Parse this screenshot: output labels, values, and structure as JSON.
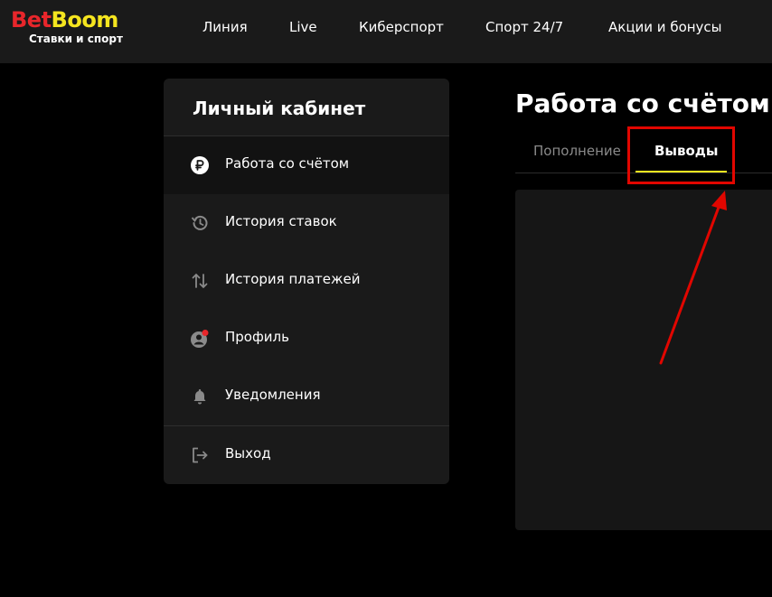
{
  "header": {
    "logo": {
      "bet": "Bet",
      "boom": "Boom",
      "tagline": "Ставки и спорт"
    },
    "nav": [
      "Линия",
      "Live",
      "Киберспорт",
      "Спорт 24/7",
      "Акции и бонусы"
    ]
  },
  "sidebar": {
    "title": "Личный кабинет",
    "items": [
      {
        "label": "Работа со счётом",
        "icon": "ruble-icon",
        "active": true
      },
      {
        "label": "История ставок",
        "icon": "history-icon"
      },
      {
        "label": "История платежей",
        "icon": "transfer-arrows-icon"
      },
      {
        "label": "Профиль",
        "icon": "profile-icon",
        "badge": true
      },
      {
        "label": "Уведомления",
        "icon": "bell-icon"
      },
      {
        "label": "Выход",
        "icon": "logout-icon"
      }
    ]
  },
  "main": {
    "title": "Работа со счётом",
    "tabs": [
      {
        "label": "Пополнение",
        "active": false
      },
      {
        "label": "Выводы",
        "active": true
      }
    ]
  },
  "colors": {
    "accent": "#f5e51f",
    "brand_red": "#e8262b",
    "annotation_red": "#e10600",
    "background": "#000000",
    "surface": "#1a1a1a"
  }
}
